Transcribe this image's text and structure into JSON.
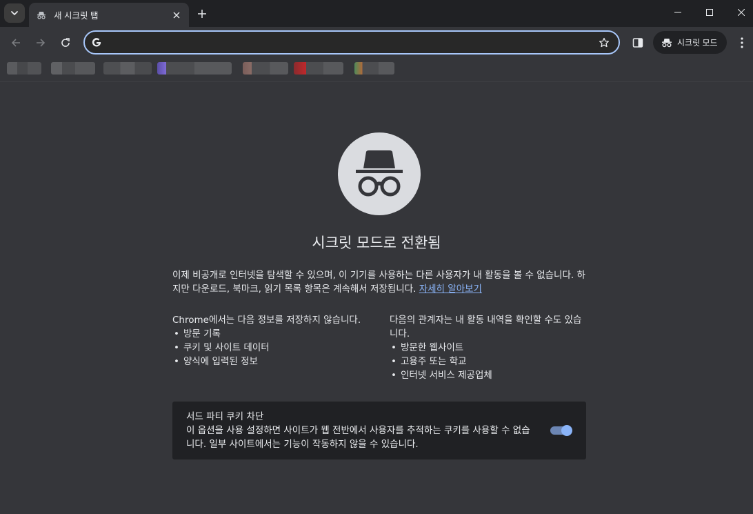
{
  "tab": {
    "title": "새 시크릿 탭"
  },
  "toolbar": {
    "omnibox_value": "",
    "incognito_chip_label": "시크릿 모드"
  },
  "main": {
    "heading": "시크릿 모드로 전환됨",
    "intro_text": "이제 비공개로 인터넷을 탐색할 수 있으며, 이 기기를 사용하는 다른 사용자가 내 활동을 볼 수 없습니다. 하지만 다운로드, 북마크, 읽기 목록 항목은 계속해서 저장됩니다.",
    "learn_more_link": "자세히 알아보기",
    "left_column": {
      "title": "Chrome에서는 다음 정보를 저장하지 않습니다.",
      "items": [
        "방문 기록",
        "쿠키 및 사이트 데이터",
        "양식에 입력된 정보"
      ]
    },
    "right_column": {
      "title": "다음의 관계자는 내 활동 내역을 확인할 수도 있습니다.",
      "items": [
        "방문한 웹사이트",
        "고용주 또는 학교",
        "인터넷 서비스 제공업체"
      ]
    },
    "cookie_card": {
      "title": "서드 파티 쿠키 차단",
      "description": "이 옵션을 사용 설정하면 사이트가 웹 전반에서 사용자를 추적하는 쿠키를 사용할 수 없습니다. 일부 사이트에서는 기능이 작동하지 않을 수 있습니다.",
      "toggle_on": true
    }
  },
  "colors": {
    "background": "#35363a",
    "accent": "#8ab4f8",
    "card": "#202124"
  }
}
